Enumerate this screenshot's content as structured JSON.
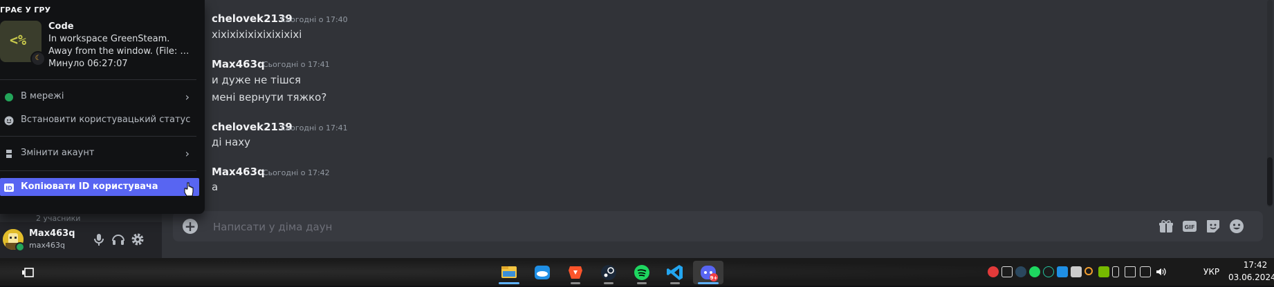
{
  "colors": {
    "accent": "#5865f2",
    "online": "#23a55a",
    "idle": "#f0b232"
  },
  "activity": {
    "header": "ГРАЄ У ГРУ",
    "icon_glyph": "<%",
    "title": "Code",
    "details": "In workspace GreenSteam.",
    "state": "Away from the window. (File: main...",
    "elapsed": "Минуло 06:27:07"
  },
  "menu": {
    "status": "В мережі",
    "custom_status": "Встановити користувацький статус",
    "switch_account": "Змінити акаунт",
    "copy_id": "Копіювати ID користувача",
    "copy_id_badge": "ID"
  },
  "server_partial": {
    "members": "2 учасники"
  },
  "user_panel": {
    "name": "Max463q",
    "tag": "max463q"
  },
  "messages": [
    {
      "author": "chelovek2139",
      "timestamp": "Сьогодні о 17:40",
      "lines": [
        "xixixixixixixixixixi"
      ]
    },
    {
      "author": "Max463q",
      "timestamp": "Сьогодні о 17:41",
      "lines": [
        "и дуже не тішся",
        "мені вернути тяжко?"
      ]
    },
    {
      "author": "chelovek2139",
      "timestamp": "Сьогодні о 17:41",
      "lines": [
        "ді наху"
      ]
    },
    {
      "author": "Max463q",
      "timestamp": "Сьогодні о 17:42",
      "lines": [
        "а"
      ]
    }
  ],
  "composer": {
    "placeholder": "Написати у діма даун"
  },
  "taskbar": {
    "apps": [
      "file-explorer",
      "onedrive",
      "brave",
      "steam",
      "spotify",
      "vscode",
      "discord"
    ],
    "discord_badge": "9+",
    "language": "УКР",
    "time": "17:42",
    "date": "03.06.2024"
  }
}
